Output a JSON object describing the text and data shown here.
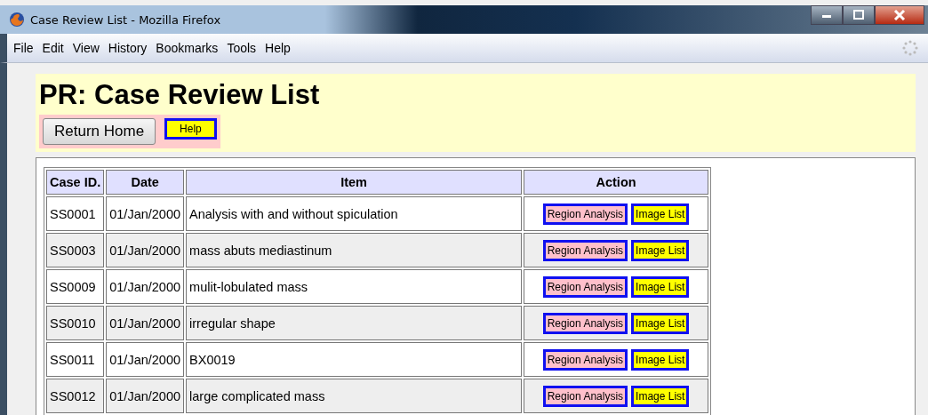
{
  "window": {
    "title": "Case Review List - Mozilla Firefox"
  },
  "menu": [
    "File",
    "Edit",
    "View",
    "History",
    "Bookmarks",
    "Tools",
    "Help"
  ],
  "page": {
    "heading": "PR: Case Review List",
    "buttons": [
      {
        "label": "Return Home",
        "kind": "plain"
      },
      {
        "label": "Help",
        "kind": "highlight"
      }
    ]
  },
  "table": {
    "columns": [
      "Case ID.",
      "Date",
      "Item",
      "Action"
    ],
    "rows": [
      {
        "case_id": "SS0001",
        "date": "01/Jan/2000",
        "item": "Analysis with and without spiculation",
        "actions": [
          "Region Analysis",
          "Image List"
        ]
      },
      {
        "case_id": "SS0003",
        "date": "01/Jan/2000",
        "item": "mass abuts mediastinum",
        "actions": [
          "Region Analysis",
          "Image List"
        ]
      },
      {
        "case_id": "SS0009",
        "date": "01/Jan/2000",
        "item": "mulit-lobulated mass",
        "actions": [
          "Region Analysis",
          "Image List"
        ]
      },
      {
        "case_id": "SS0010",
        "date": "01/Jan/2000",
        "item": "irregular shape",
        "actions": [
          "Region Analysis",
          "Image List"
        ]
      },
      {
        "case_id": "SS0011",
        "date": "01/Jan/2000",
        "item": "BX0019",
        "actions": [
          "Region Analysis",
          "Image List"
        ]
      },
      {
        "case_id": "SS0012",
        "date": "01/Jan/2000",
        "item": "large complicated mass",
        "actions": [
          "Region Analysis",
          "Image List"
        ]
      }
    ]
  }
}
